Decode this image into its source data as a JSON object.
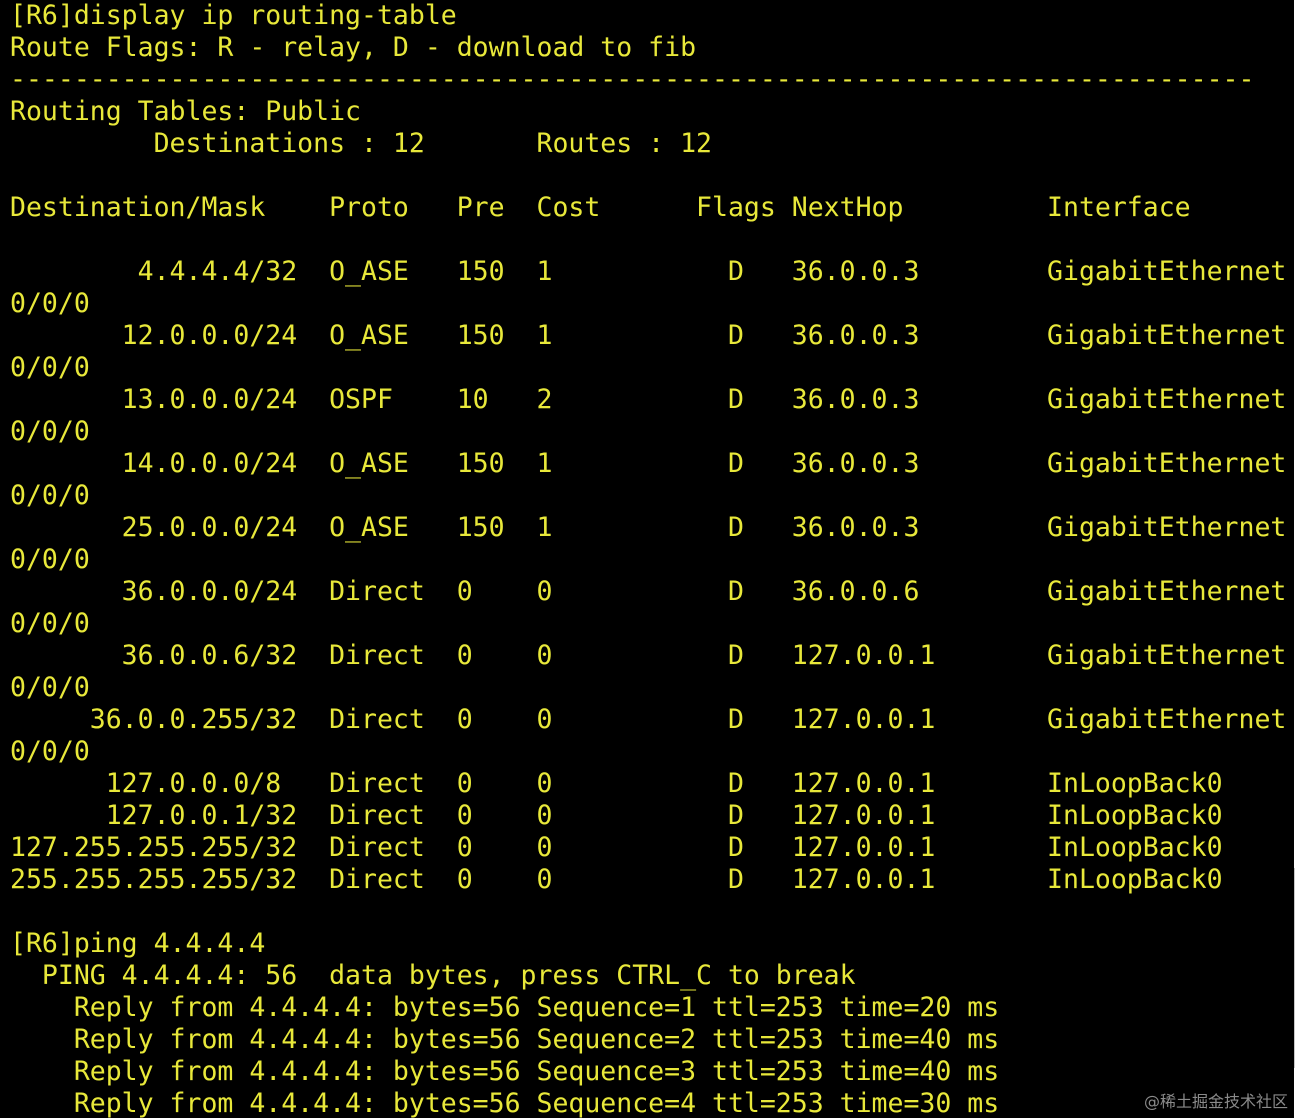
{
  "terminal": {
    "lines": [
      "[R6]display ip routing-table",
      "Route Flags: R - relay, D - download to fib",
      "------------------------------------------------------------------------------",
      "Routing Tables: Public",
      "         Destinations : 12       Routes : 12",
      "",
      "Destination/Mask    Proto   Pre  Cost      Flags NextHop         Interface",
      "",
      "        4.4.4.4/32  O_ASE   150  1           D   36.0.0.3        GigabitEthernet",
      "0/0/0",
      "       12.0.0.0/24  O_ASE   150  1           D   36.0.0.3        GigabitEthernet",
      "0/0/0",
      "       13.0.0.0/24  OSPF    10   2           D   36.0.0.3        GigabitEthernet",
      "0/0/0",
      "       14.0.0.0/24  O_ASE   150  1           D   36.0.0.3        GigabitEthernet",
      "0/0/0",
      "       25.0.0.0/24  O_ASE   150  1           D   36.0.0.3        GigabitEthernet",
      "0/0/0",
      "       36.0.0.0/24  Direct  0    0           D   36.0.0.6        GigabitEthernet",
      "0/0/0",
      "       36.0.0.6/32  Direct  0    0           D   127.0.0.1       GigabitEthernet",
      "0/0/0",
      "     36.0.0.255/32  Direct  0    0           D   127.0.0.1       GigabitEthernet",
      "0/0/0",
      "      127.0.0.0/8   Direct  0    0           D   127.0.0.1       InLoopBack0",
      "      127.0.0.1/32  Direct  0    0           D   127.0.0.1       InLoopBack0",
      "127.255.255.255/32  Direct  0    0           D   127.0.0.1       InLoopBack0",
      "255.255.255.255/32  Direct  0    0           D   127.0.0.1       InLoopBack0",
      "",
      "[R6]ping 4.4.4.4",
      "  PING 4.4.4.4: 56  data bytes, press CTRL_C to break",
      "    Reply from 4.4.4.4: bytes=56 Sequence=1 ttl=253 time=20 ms",
      "    Reply from 4.4.4.4: bytes=56 Sequence=2 ttl=253 time=40 ms",
      "    Reply from 4.4.4.4: bytes=56 Sequence=3 ttl=253 time=40 ms",
      "    Reply from 4.4.4.4: bytes=56 Sequence=4 ttl=253 time=30 ms"
    ],
    "text_color": "#e8e83a",
    "background_color": "#000000"
  },
  "watermark": "@稀土掘金技术社区"
}
